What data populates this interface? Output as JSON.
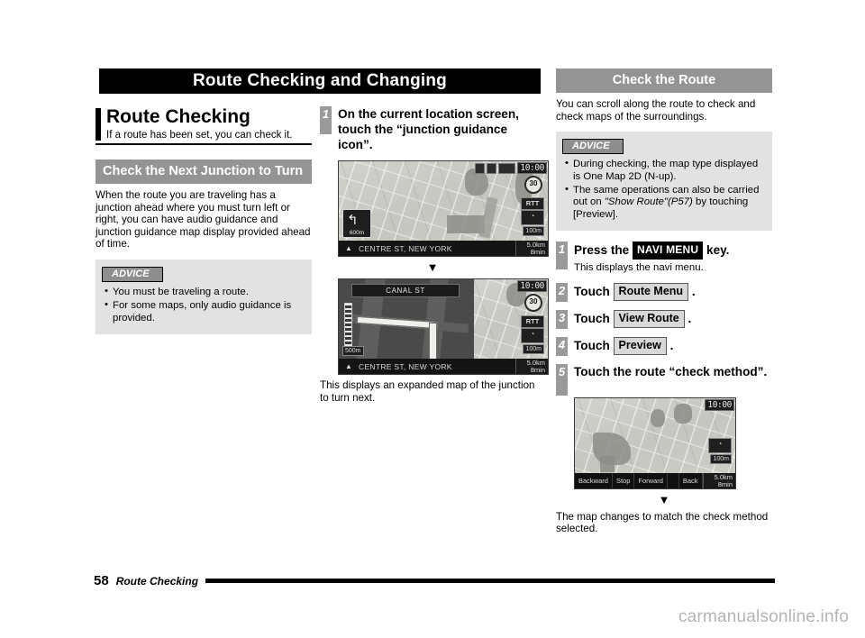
{
  "page": {
    "title": "Route Checking and Changing",
    "footer_page_number": "58",
    "footer_label": "Route Checking",
    "watermark": "carmanualsonline.info"
  },
  "left_column": {
    "section_title": "Route Checking",
    "section_subtitle": "If a route has been set, you can check it.",
    "sub_header": "Check the Next Junction to Turn",
    "body": "When the route you are traveling has a junction ahead where you must turn left or right, you can have audio guidance and junction guidance map display provided ahead of time.",
    "advice": {
      "tag": "ADVICE",
      "items": [
        "You must be traveling a route.",
        "For some maps, only audio guidance is provided."
      ]
    }
  },
  "middle_column": {
    "step": {
      "number": "1",
      "text": "On the current location screen, touch the “junction guidance icon”."
    },
    "arrow": "▼",
    "caption": "This displays an expanded map of the junction to turn next.",
    "screenshot_1": {
      "clock": "10:00",
      "speed_limit": "30",
      "rtt_button": "RTT",
      "compass_icon": "compass-icon",
      "scale": "100m",
      "junction_distance": "600m",
      "junction_arrow": "turn-left-icon",
      "street": "CENTRE ST, NEW YORK",
      "distance": "5.0km",
      "eta": "8min"
    },
    "screenshot_2": {
      "clock": "10:00",
      "speed_limit": "30",
      "rtt_button": "RTT",
      "compass_icon": "compass-icon",
      "scale": "100m",
      "junction_street": "CANAL ST",
      "junction_scale": "500m",
      "street": "CENTRE ST, NEW YORK",
      "distance": "5.0km",
      "eta": "8min"
    }
  },
  "right_column": {
    "sub_header": "Check the Route",
    "body": "You can scroll along the route to check and check maps of the surroundings.",
    "advice": {
      "tag": "ADVICE",
      "items": [
        "During checking, the map type displayed is One Map 2D (N-up).",
        "The same operations can also be carried out on \"Show Route\"(P57) by touching [Preview]."
      ],
      "item2_prefix": "The same operations can also be carried out on ",
      "item2_italic": "\"Show Route\"(P57)",
      "item2_suffix": " by touching [Preview]."
    },
    "steps": [
      {
        "number": "1",
        "prefix": "Press the ",
        "key": "NAVI MENU",
        "suffix": " key.",
        "note": "This displays the navi menu."
      },
      {
        "number": "2",
        "prefix": "Touch ",
        "key": "Route Menu",
        "suffix": " ."
      },
      {
        "number": "3",
        "prefix": "Touch ",
        "key": "View Route",
        "suffix": " ."
      },
      {
        "number": "4",
        "prefix": "Touch ",
        "key": "Preview",
        "suffix": " ."
      },
      {
        "number": "5",
        "text": "Touch the route “check method”."
      }
    ],
    "arrow": "▼",
    "caption": "The map changes to match the check method selected.",
    "screenshot_3": {
      "clock": "10:00",
      "scale": "100m",
      "controls": [
        "Backward",
        "Stop",
        "Forward",
        "Back"
      ],
      "distance": "5.0km",
      "eta": "8min"
    }
  }
}
